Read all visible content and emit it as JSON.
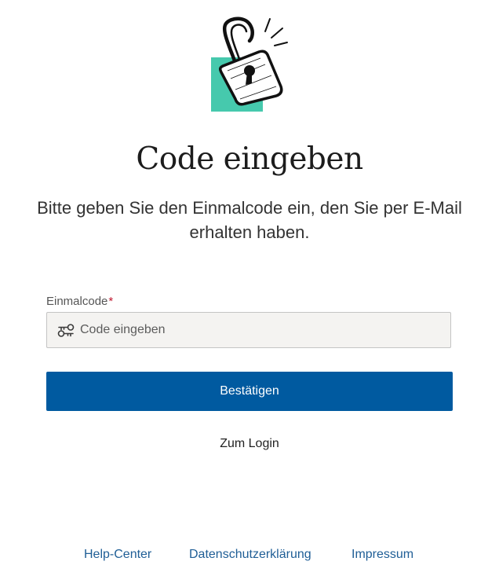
{
  "illustration": {
    "icon": "unlocked-padlock-icon",
    "accent_color": "#46c9ad"
  },
  "page": {
    "title": "Code eingeben",
    "subtitle": "Bitte geben Sie den Einmalcode ein, den Sie per E-Mail erhalten haben."
  },
  "form": {
    "field_label": "Einmalcode",
    "required_marker": "*",
    "input_icon": "key-icon",
    "input_value": "",
    "input_placeholder": "Code eingeben",
    "submit_label": "Bestätigen",
    "submit_color": "#005aa0"
  },
  "links": {
    "login": "Zum Login"
  },
  "footer": {
    "help": "Help-Center",
    "privacy": "Datenschutzerklärung",
    "imprint": "Impressum",
    "link_color": "#1f5e96"
  }
}
